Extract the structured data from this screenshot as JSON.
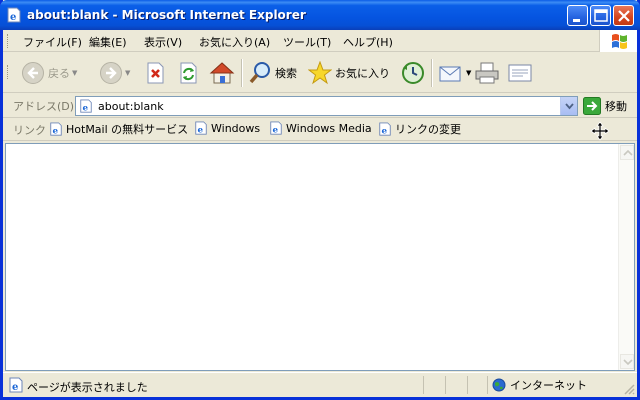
{
  "window": {
    "title": "about:blank - Microsoft Internet Explorer",
    "icon": "ie-page-icon",
    "controls": [
      "minimize-icon",
      "maximize-icon",
      "close-icon"
    ]
  },
  "menu": {
    "items": [
      "ファイル(F)",
      "編集(E)",
      "表示(V)",
      "お気に入り(A)",
      "ツール(T)",
      "ヘルプ(H)"
    ]
  },
  "toolbar": {
    "back_label": "戻る",
    "search_label": "検索",
    "favorites_label": "お気に入り",
    "icons": [
      "back-icon",
      "forward-icon",
      "stop-icon",
      "refresh-icon",
      "home-icon",
      "search-icon",
      "favorites-star-icon",
      "history-icon",
      "mail-icon",
      "print-icon",
      "edit-icon"
    ]
  },
  "address": {
    "label": "アドレス(D)",
    "value": "about:blank",
    "go_label": "移動"
  },
  "links": {
    "label": "リンク",
    "items": [
      "HotMail の無料サービス",
      "Windows",
      "Windows Media",
      "リンクの変更"
    ]
  },
  "status": {
    "text": "ページが表示されました",
    "zone": "インターネット"
  },
  "colors": {
    "titlebar": "#0554e0",
    "chrome": "#ece9d8",
    "close_button": "#d5451e"
  }
}
